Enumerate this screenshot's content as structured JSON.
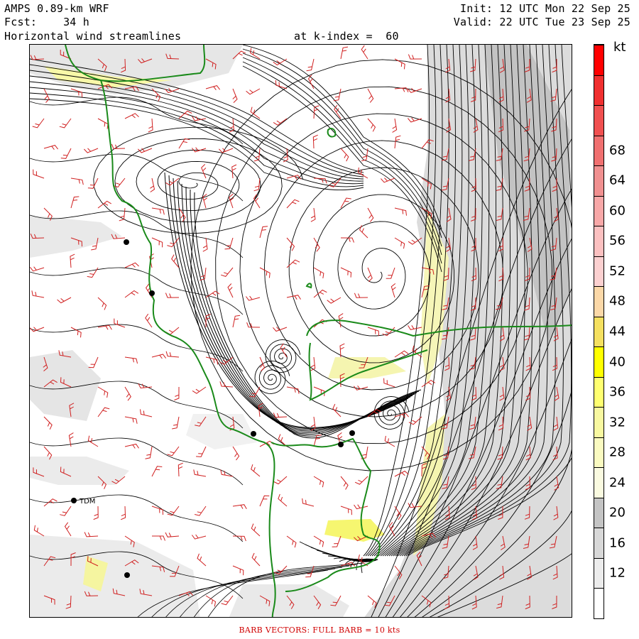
{
  "header": {
    "model": "AMPS 0.89-km WRF",
    "forecast": "Fcst:    34 h",
    "product": "Horizontal wind streamlines",
    "level": "at k-index =  60",
    "init": "Init: 12 UTC Mon 22 Sep 25",
    "valid": "Valid: 22 UTC Tue 23 Sep 25"
  },
  "colorbar": {
    "unit": "kt",
    "labels": [
      "12",
      "16",
      "20",
      "24",
      "28",
      "32",
      "36",
      "40",
      "44",
      "48",
      "52",
      "56",
      "60",
      "64",
      "68"
    ],
    "colors": [
      "#ffffff",
      "#ececec",
      "#d8d8d8",
      "#c4c4c4",
      "#fafae0",
      "#fafac0",
      "#f8f8a0",
      "#ffff70",
      "#ffff00",
      "#f5e060",
      "#fbd8a8",
      "#fbd0d0",
      "#fbc0c0",
      "#f8a8a8",
      "#f09090",
      "#f07070",
      "#f05050",
      "#f03030",
      "#ff0000"
    ]
  },
  "stations": [
    {
      "label": "TDM"
    }
  ],
  "colors": {
    "coastline": "#1a8a1a",
    "barb": "#d02020",
    "streamline": "#000000"
  },
  "footer": {
    "text": "BARB VECTORS:  FULL BARB = 10 kts"
  }
}
